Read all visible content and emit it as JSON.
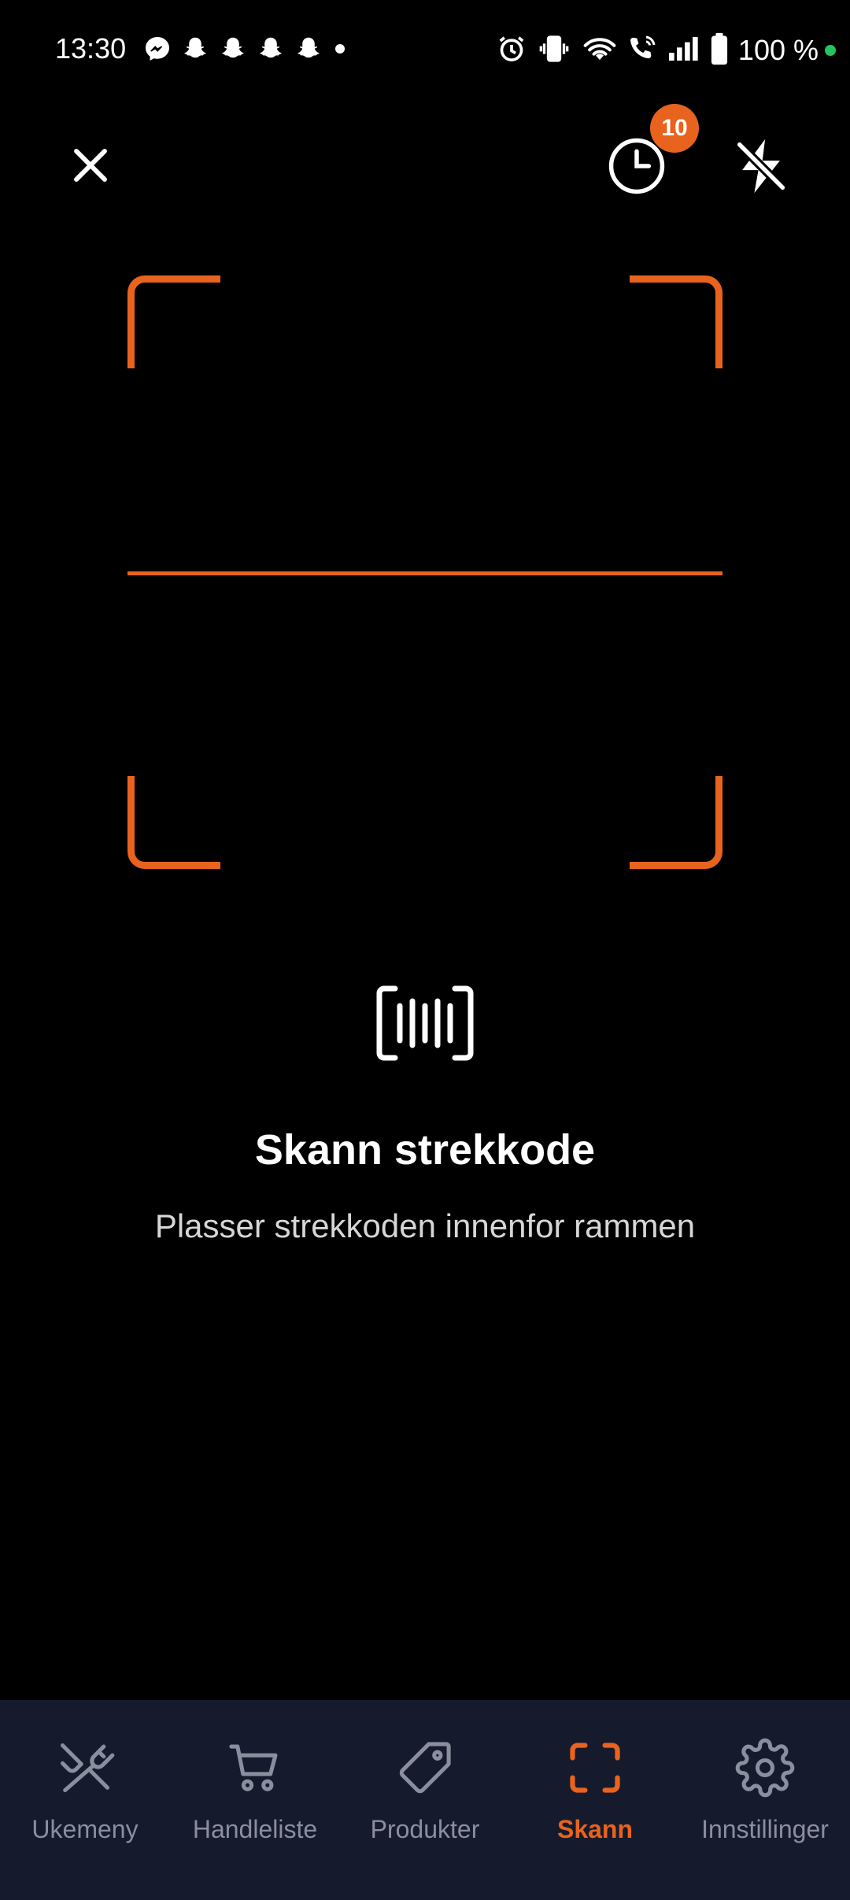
{
  "status_bar": {
    "time": "13:30",
    "notification_icons": [
      "messenger-icon",
      "snapchat-icon",
      "snapchat-icon",
      "snapchat-icon",
      "snapchat-icon",
      "more-dot-icon"
    ],
    "system_icons": [
      "alarm-icon",
      "vibrate-icon",
      "wifi-icon",
      "wifi-calling-icon",
      "signal-icon",
      "battery-icon"
    ],
    "battery": "100 %",
    "indicator_color": "#22c55e"
  },
  "top_bar": {
    "close_icon": "close-icon",
    "history_icon": "history-clock-icon",
    "history_badge": "10",
    "flash_icon": "flash-off-icon"
  },
  "scanner": {
    "frame_color": "#e8631e",
    "icon": "barcode-icon",
    "title": "Skann strekkode",
    "subtitle": "Plasser strekkoden innenfor rammen"
  },
  "nav": {
    "items": [
      {
        "label": "Ukemeny",
        "icon": "cutlery-icon",
        "active": false
      },
      {
        "label": "Handleliste",
        "icon": "cart-icon",
        "active": false
      },
      {
        "label": "Produkter",
        "icon": "tag-icon",
        "active": false
      },
      {
        "label": "Skann",
        "icon": "scan-icon",
        "active": true
      },
      {
        "label": "Innstillinger",
        "icon": "gear-icon",
        "active": false
      }
    ],
    "active_color": "#e8631e",
    "inactive_color": "#8a8f9e",
    "background": "#151a2c"
  }
}
